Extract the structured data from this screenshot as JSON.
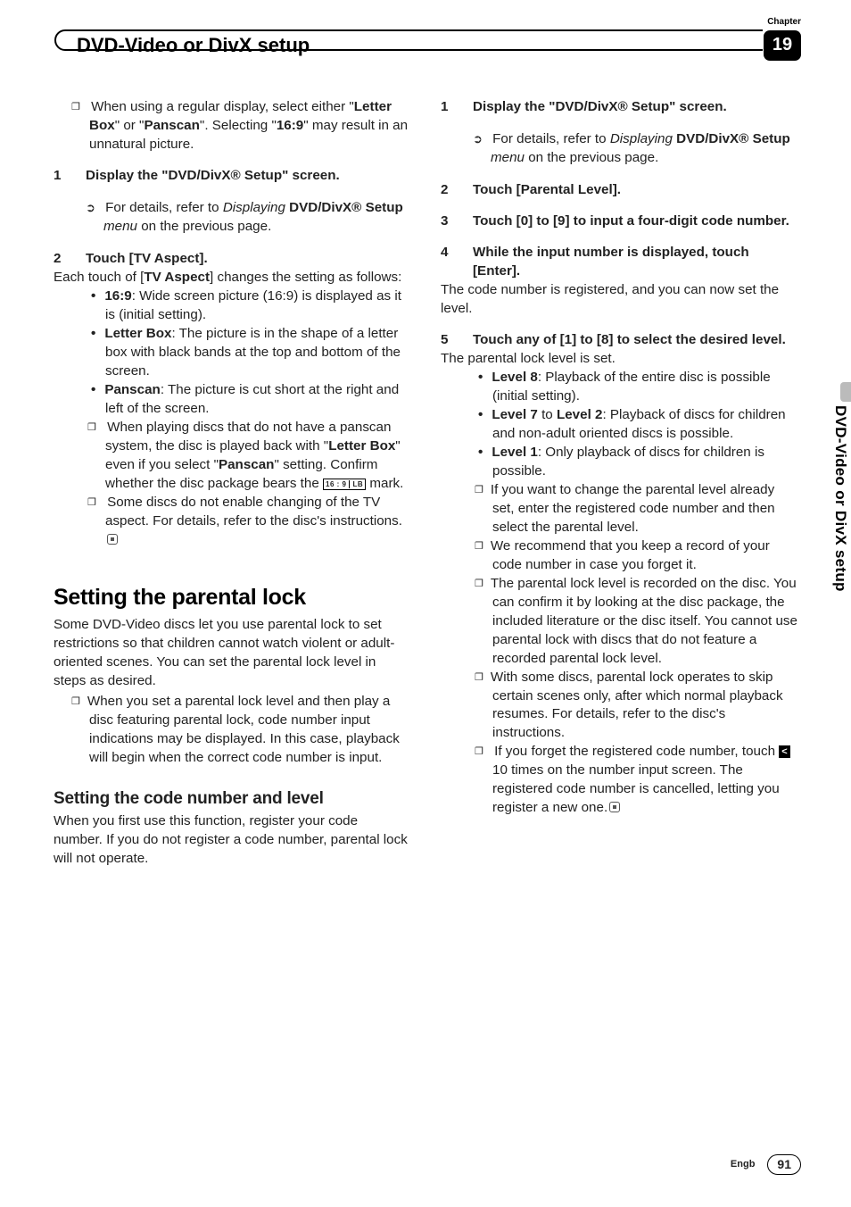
{
  "header": {
    "title": "DVD-Video or DivX setup",
    "chapter_label": "Chapter",
    "chapter_number": "19"
  },
  "side_tab": "DVD-Video or DivX setup",
  "footer": {
    "lang": "Engb",
    "page": "91"
  },
  "left": {
    "intro_note_a": "When using a regular display, select either \"",
    "intro_note_b": "\" or \"",
    "intro_note_c": "\". Selecting \"",
    "intro_note_d": "\" may result in an unnatural picture.",
    "letterbox": "Letter Box",
    "panscan": "Panscan",
    "r169q": "16:9",
    "s1_num": "1",
    "s1_txt": "Display the \"DVD/DivX® Setup\" screen.",
    "s1_sub_a": "For details, refer to ",
    "s1_sub_ital": "Displaying ",
    "s1_sub_bold": "DVD/DivX® Setup ",
    "s1_sub_ital2": "menu ",
    "s1_sub_tail": "on the previous page.",
    "s2_num": "2",
    "s2_txt": "Touch [TV Aspect].",
    "s2_body_a": "Each touch of [",
    "s2_body_bold": "TV Aspect",
    "s2_body_b": "] changes the setting as follows:",
    "b1_k": "16:9",
    "b1_v": ": Wide screen picture (16:9) is displayed as it is (initial setting).",
    "b2_k": "Letter Box",
    "b2_v": ": The picture is in the shape of a letter box with black bands at the top and bottom of the screen.",
    "b3_k": "Panscan",
    "b3_v": ": The picture is cut short at the right and left of the screen.",
    "n1_a": "When playing discs that do not have a panscan system, the disc is played back with \"",
    "n1_lb": "Letter Box",
    "n1_b": "\" even if you select \"",
    "n1_ps": "Panscan",
    "n1_c": "\" setting. Confirm whether the disc package bears the ",
    "lb_mark_a": "16 : 9",
    "lb_mark_b": "LB",
    "n1_d": " mark.",
    "n2": "Some discs do not enable changing of the TV aspect. For details, refer to the disc's instructions.",
    "h2": "Setting the parental lock",
    "h2_body": "Some DVD-Video discs let you use parental lock to set restrictions so that children cannot watch violent or adult-oriented scenes. You can set the parental lock level in steps as desired.",
    "h2_note": "When you set a parental lock level and then play a disc featuring parental lock, code number input indications may be displayed. In this case, playback will begin when the correct code number is input.",
    "h3": "Setting the code number and level",
    "h3_body": "When you first use this function, register your code number. If you do not register a code number, parental lock will not operate."
  },
  "right": {
    "s1_num": "1",
    "s1_txt": "Display the \"DVD/DivX® Setup\" screen.",
    "s1_sub_a": "For details, refer to ",
    "s1_sub_ital": "Displaying ",
    "s1_sub_bold": "DVD/DivX® Setup ",
    "s1_sub_ital2": "menu ",
    "s1_sub_tail": "on the previous page.",
    "s2_num": "2",
    "s2_txt": "Touch [Parental Level].",
    "s3_num": "3",
    "s3_txt": "Touch [0] to [9] to input a four-digit code number.",
    "s4_num": "4",
    "s4_txt": "While the input number is displayed, touch [Enter].",
    "s4_body": "The code number is registered, and you can now set the level.",
    "s5_num": "5",
    "s5_txt": "Touch any of [1] to [8] to select the desired level.",
    "s5_body": "The parental lock level is set.",
    "lvl8_k": "Level 8",
    "lvl8_v": ": Playback of the entire disc is possible (initial setting).",
    "lvl72_k1": "Level 7",
    "lvl72_mid": " to ",
    "lvl72_k2": "Level 2",
    "lvl72_v": ": Playback of discs for children and non-adult oriented discs is possible.",
    "lvl1_k": "Level 1",
    "lvl1_v": ": Only playback of discs for children is possible.",
    "rn1": "If you want to change the parental level already set, enter the registered code number and then select the parental level.",
    "rn2": "We recommend that you keep a record of your code number in case you forget it.",
    "rn3": "The parental lock level is recorded on the disc. You can confirm it by looking at the disc package, the included literature or the disc itself. You cannot use parental lock with discs that do not feature a recorded parental lock level.",
    "rn4": "With some discs, parental lock operates to skip certain scenes only, after which normal playback resumes. For details, refer to the disc's instructions.",
    "rn5_a": "If you forget the registered code number, touch ",
    "rn5_b": " 10 times on the number input screen. The registered code number is cancelled, letting you register a new one."
  }
}
